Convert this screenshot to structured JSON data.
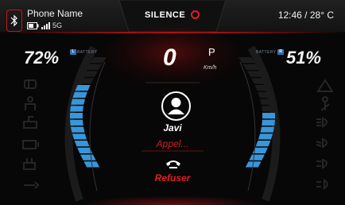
{
  "status_bar": {
    "phone_name": "Phone Name",
    "network": "5G",
    "clock_temp": "12:46 / 28° C",
    "icons": [
      "bluetooth-icon",
      "battery-icon",
      "signal-icon"
    ]
  },
  "brand": {
    "logo_text": "SILENCE"
  },
  "battery_left": {
    "percent": "72%",
    "label": "BATTERY",
    "badge": "L",
    "level": 0.72
  },
  "battery_right": {
    "percent": "51%",
    "label": "BATTERY",
    "badge": "R",
    "level": 0.51
  },
  "speed": {
    "value": "0",
    "gear": "P",
    "unit": "Km/h"
  },
  "call": {
    "caller": "Javi",
    "status": "Appel...",
    "reject_label": "Refuser"
  },
  "left_icons": [
    "door-open-icon",
    "person-seat-icon",
    "engine-icon",
    "battery-warning-icon",
    "charge-plug-icon",
    "wrench-icon"
  ],
  "right_icons": [
    "warning-triangle-icon",
    "seatbelt-icon",
    "high-beam-icon",
    "low-beam-icon",
    "headlight-icon",
    "fog-light-icon"
  ],
  "colors": {
    "accent": "#e41c22",
    "battery_blue": "#3a96d8",
    "background": "#070707"
  }
}
